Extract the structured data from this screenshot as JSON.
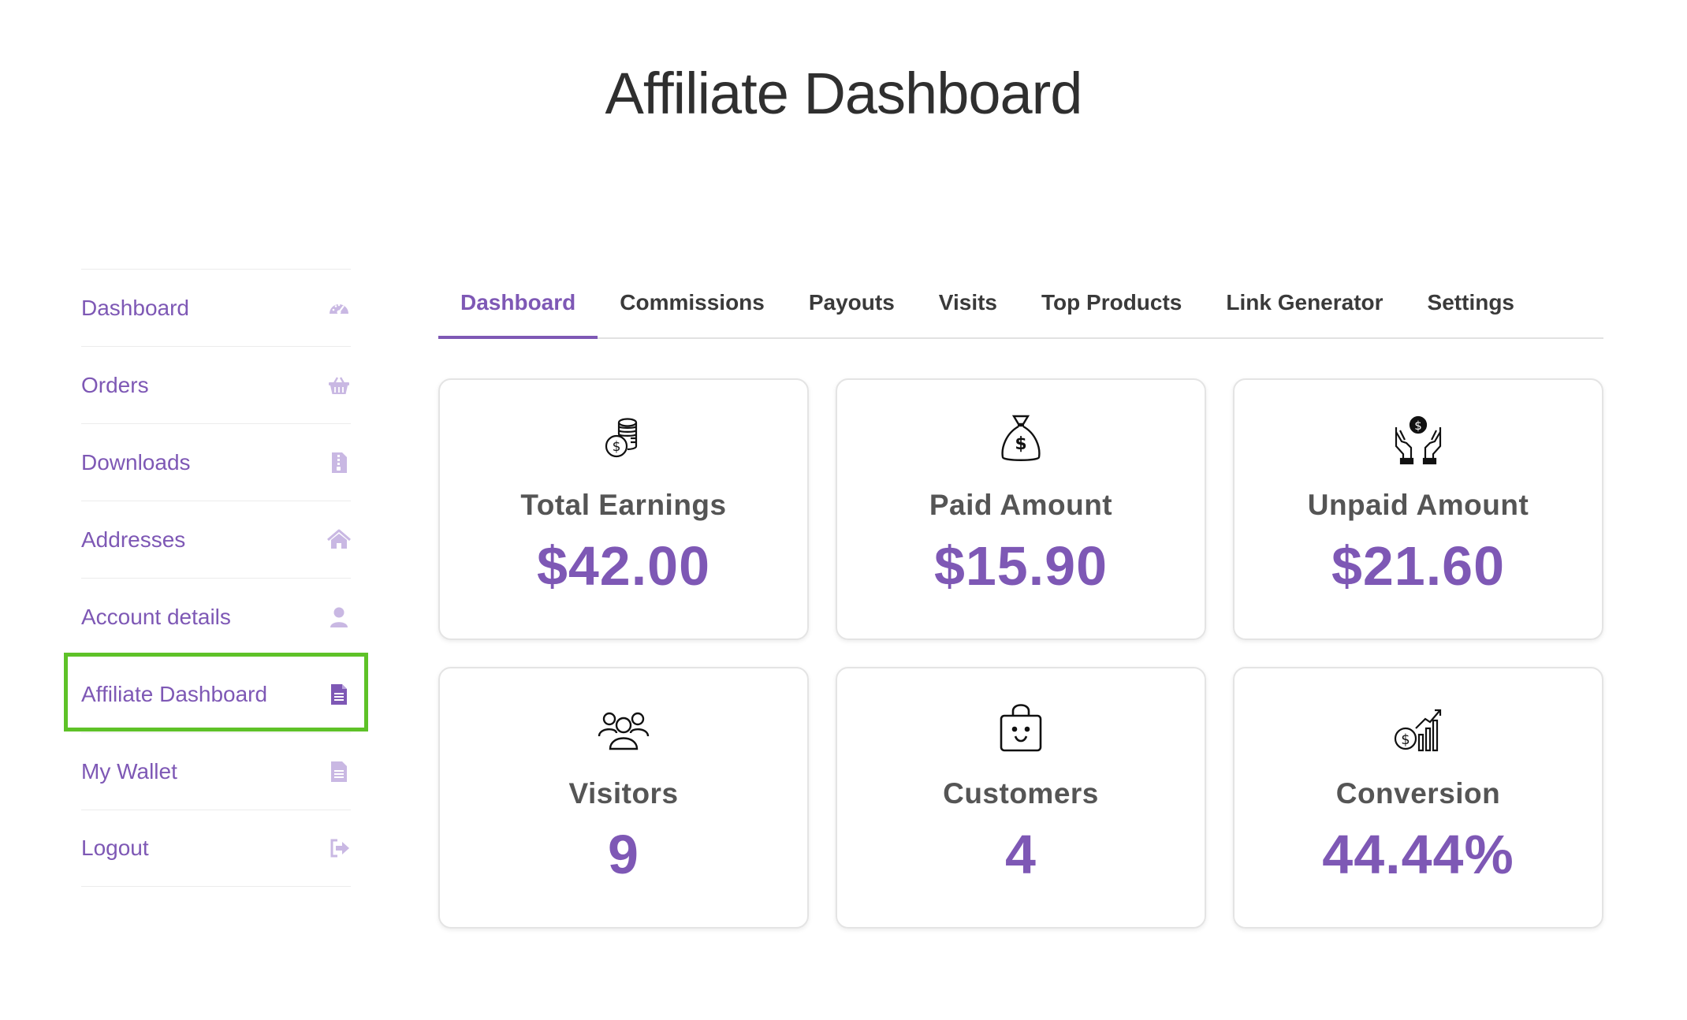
{
  "page": {
    "title": "Affiliate Dashboard"
  },
  "sidebar": {
    "items": [
      {
        "label": "Dashboard",
        "icon": "gauge-icon"
      },
      {
        "label": "Orders",
        "icon": "basket-icon"
      },
      {
        "label": "Downloads",
        "icon": "file-download-icon"
      },
      {
        "label": "Addresses",
        "icon": "home-icon"
      },
      {
        "label": "Account details",
        "icon": "user-icon"
      },
      {
        "label": "Affiliate Dashboard",
        "icon": "document-icon",
        "active": true
      },
      {
        "label": "My Wallet",
        "icon": "document-icon"
      },
      {
        "label": "Logout",
        "icon": "sign-out-icon"
      }
    ]
  },
  "tabs": [
    {
      "label": "Dashboard",
      "active": true
    },
    {
      "label": "Commissions"
    },
    {
      "label": "Payouts"
    },
    {
      "label": "Visits"
    },
    {
      "label": "Top Products"
    },
    {
      "label": "Link Generator"
    },
    {
      "label": "Settings"
    }
  ],
  "cards": [
    {
      "label": "Total Earnings",
      "value": "$42.00",
      "icon": "coins-icon"
    },
    {
      "label": "Paid Amount",
      "value": "$15.90",
      "icon": "money-bag-icon"
    },
    {
      "label": "Unpaid Amount",
      "value": "$21.60",
      "icon": "hands-coin-icon"
    },
    {
      "label": "Visitors",
      "value": "9",
      "icon": "users-icon"
    },
    {
      "label": "Customers",
      "value": "4",
      "icon": "shopping-bag-icon"
    },
    {
      "label": "Conversion",
      "value": "44.44%",
      "icon": "growth-chart-icon"
    }
  ],
  "colors": {
    "accent": "#7e58b5",
    "sidebar_icon": "#c9b8e3",
    "highlight": "#5ec228"
  }
}
